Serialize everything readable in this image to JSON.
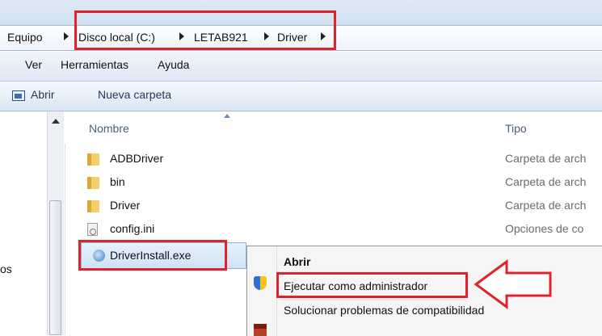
{
  "breadcrumb": [
    "Equipo",
    "Disco local (C:)",
    "LETAB921",
    "Driver"
  ],
  "menu": [
    "Ver",
    "Herramientas",
    "Ayuda"
  ],
  "toolbar": {
    "open_label": "Abrir",
    "new_folder_label": "Nueva carpeta"
  },
  "columns": {
    "name": "Nombre",
    "type": "Tipo"
  },
  "files": [
    {
      "name": "ADBDriver",
      "type": "Carpeta de arch"
    },
    {
      "name": "bin",
      "type": "Carpeta de arch"
    },
    {
      "name": "Driver",
      "type": "Carpeta de arch"
    },
    {
      "name": "config.ini",
      "type": "Opciones de co"
    }
  ],
  "selected_file": "DriverInstall.exe",
  "nav_label": "os",
  "context_menu": [
    "Abrir",
    "Ejecutar como administrador",
    "Solucionar problemas de compatibilidad"
  ],
  "colors": {
    "highlight": "#e0222b",
    "selection": "#cfe3f7"
  }
}
